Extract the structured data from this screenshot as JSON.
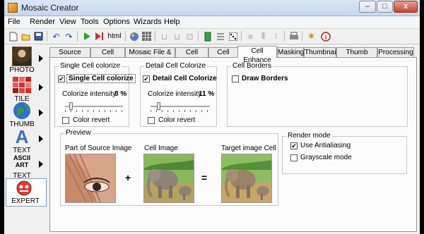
{
  "window": {
    "title": "Mosaic Creator",
    "minimize": "–",
    "maximize": "□",
    "close": "x"
  },
  "menu": [
    "File",
    "Render",
    "View",
    "Tools",
    "Options",
    "Wizards",
    "Help"
  ],
  "toolbar": {
    "html_label": "html"
  },
  "sidebar": [
    {
      "label": "PHOTO",
      "icon": "mona-lisa-icon"
    },
    {
      "label": "TILE",
      "icon": "tiles-icon"
    },
    {
      "label": "THUMB",
      "icon": "globe-icon"
    },
    {
      "label": "TEXT",
      "icon": "letter-a-icon",
      "glyph": "A"
    },
    {
      "label": "TEXT",
      "icon": "ascii-art-icon",
      "glyph": "ASCII ART"
    },
    {
      "label": "EXPERT",
      "icon": "expert-face-icon"
    }
  ],
  "tabs": [
    "Source Image",
    "Cell Images",
    "Mosaic File & Size",
    "Cell Shape",
    "Cell filling",
    "Cell Enhance",
    "Masking",
    "Thumbnail",
    "Thumb Images",
    "Processing"
  ],
  "selected_tab": "Cell Enhance",
  "single": {
    "group": "Single Cell colorize",
    "check_label": "Single Cell colorize",
    "checked": true,
    "intensity_label": "Colorize intensity",
    "intensity_value": "8 %",
    "slider_level": 0.08,
    "revert_label": "Color revert",
    "revert_checked": false
  },
  "detail": {
    "group": "Detail Cell Colorize",
    "check_label": "Detail Cell Colorize",
    "checked": true,
    "intensity_label": "Colorize intensity",
    "intensity_value": "11 %",
    "slider_level": 0.11,
    "revert_label": "Color revert",
    "revert_checked": false
  },
  "borders": {
    "group": "Cell Borders",
    "check_label": "Draw Borders",
    "checked": false
  },
  "preview": {
    "group": "Preview",
    "source_label": "Part of Source Image",
    "cell_label": "Cell Image",
    "target_label": "Target image Cell",
    "plus": "+",
    "equals": "="
  },
  "render_mode": {
    "group": "Render mode",
    "antialias_label": "Use Antialiasing",
    "antialias_checked": true,
    "grayscale_label": "Grayscale mode",
    "grayscale_checked": false
  }
}
